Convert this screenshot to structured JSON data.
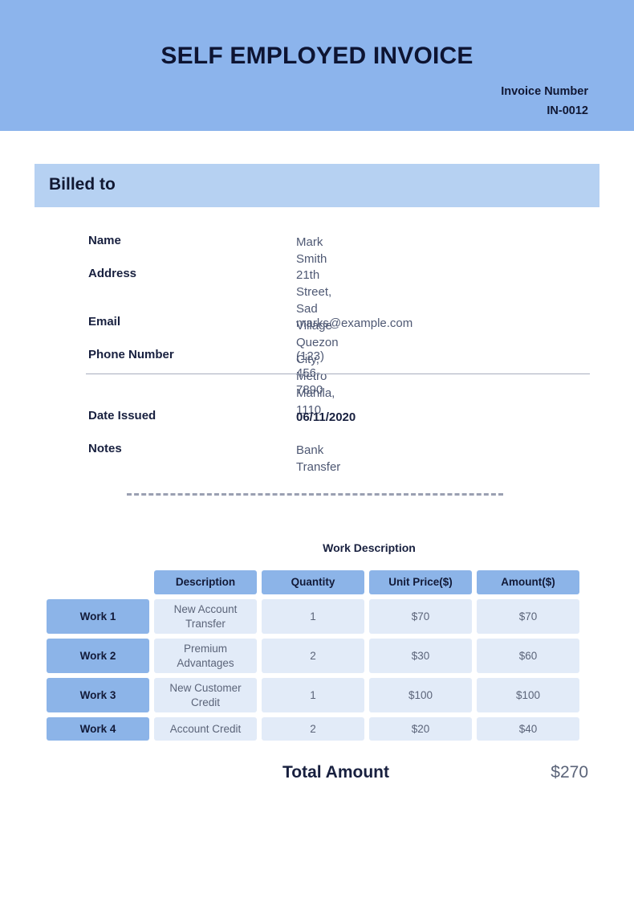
{
  "header": {
    "title": "SELF EMPLOYED INVOICE",
    "invoice_number_label": "Invoice Number",
    "invoice_number_value": "IN-0012",
    "band_color": "#8cb4ec"
  },
  "billed_to": {
    "section_title": "Billed to",
    "band_color": "#b6d1f2",
    "fields": [
      {
        "label": "Name",
        "value": "Mark Smith"
      },
      {
        "label": "Address",
        "value": "21th Street, Sad Village\nQuezon City, Metro Manila, 1110"
      },
      {
        "label": "Email",
        "value": "marks@example.com"
      },
      {
        "label": "Phone Number",
        "value": "(123) 456-7890"
      }
    ]
  },
  "meta": {
    "fields": [
      {
        "label": "Date Issued",
        "value": "06/11/2020"
      },
      {
        "label": "Notes",
        "value": "Bank Transfer"
      }
    ]
  },
  "work": {
    "section_title": "Work Description",
    "columns": [
      "Description",
      "Quantity",
      "Unit Price($)",
      "Amount($)"
    ],
    "rows": [
      {
        "work_label": "Work 1",
        "description": "New Account Transfer",
        "quantity": "1",
        "unit_price": "$70",
        "amount": "$70"
      },
      {
        "work_label": "Work 2",
        "description": "Premium Advantages",
        "quantity": "2",
        "unit_price": "$30",
        "amount": "$60"
      },
      {
        "work_label": "Work 3",
        "description": "New Customer Credit",
        "quantity": "1",
        "unit_price": "$100",
        "amount": "$100"
      },
      {
        "work_label": "Work 4",
        "description": "Account Credit",
        "quantity": "2",
        "unit_price": "$20",
        "amount": "$40"
      }
    ],
    "header_color": "#8cb4e8",
    "cell_color": "#e2ebf8"
  },
  "total": {
    "label": "Total Amount",
    "value": "$270"
  }
}
